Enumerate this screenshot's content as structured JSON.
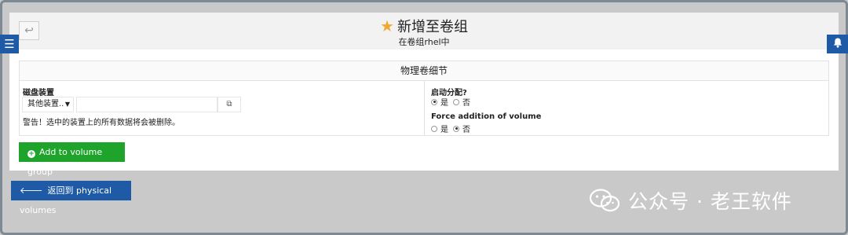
{
  "header": {
    "title": "新增至卷组",
    "subtitle": "在卷组rhel中",
    "back_glyph": "↩",
    "title_icon": "star-icon",
    "colors": {
      "star": "#f0a830",
      "header_bg": "#f2f2f2"
    }
  },
  "side": {
    "menu_icon": "hamburger-menu-icon",
    "notifications_icon": "bell-icon",
    "accent": "#1f5aa6"
  },
  "details": {
    "heading": "物理卷细节",
    "disk": {
      "label": "磁盘装置",
      "select_value": "其他装置..",
      "input_value": "",
      "warning": "警告！选中的装置上的所有数据将会被删除。"
    },
    "allocation": {
      "label": "启动分配?",
      "options": [
        "是",
        "否"
      ],
      "selected": "是"
    },
    "force": {
      "label": "Force addition of volume",
      "options": [
        "是",
        "否"
      ],
      "selected": "否"
    }
  },
  "actions": {
    "add_label": "Add to volume group",
    "add_color": "#1ea32b",
    "return_label": "返回到 physical volumes",
    "return_color": "#1f5aa6"
  },
  "watermark": {
    "text": "公众号 · 老王软件",
    "icon": "wechat-icon"
  }
}
